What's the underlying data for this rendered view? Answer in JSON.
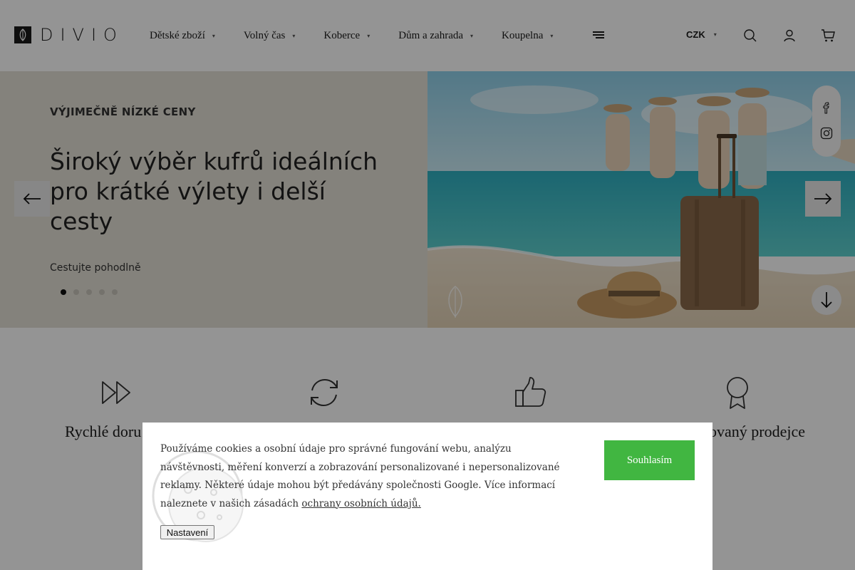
{
  "brand": {
    "name": "DIVIO"
  },
  "nav": {
    "items": [
      {
        "label": "Dětské zboží"
      },
      {
        "label": "Volný čas"
      },
      {
        "label": "Koberce"
      },
      {
        "label": "Dům a zahrada"
      },
      {
        "label": "Koupelna"
      }
    ]
  },
  "header": {
    "currency": "CZK",
    "icons": [
      "search-icon",
      "user-icon",
      "cart-icon"
    ]
  },
  "hero": {
    "eyebrow": "VÝJIMEČNĚ NÍZKÉ CENY",
    "headline": "Široký výběr kufrů ideálních pro krátké výlety i delší cesty",
    "subline": "Cestujte pohodlně",
    "slides_total": 5,
    "active_slide": 1,
    "social": [
      "facebook-icon",
      "instagram-icon"
    ]
  },
  "features": {
    "items": [
      {
        "label": "Rychlé doru",
        "icon": "fast-forward-icon"
      },
      {
        "label": "",
        "icon": "refresh-icon"
      },
      {
        "label": "",
        "icon": "thumbs-up-icon"
      },
      {
        "label": "ovaný prodejce",
        "icon": "award-icon"
      }
    ]
  },
  "cookie": {
    "text": "Používáme cookies a osobní údaje pro správné fungování webu, analýzu návštěvnosti, měření konverzí a zobrazování personalizované i nepersonalizované reklamy. Některé údaje mohou být předávány společnosti Google. Více informací naleznete v našich zásadách ",
    "link_label": "ochrany osobních údajů.",
    "accept_label": "Souhlasím",
    "settings_label": "Nastavení"
  },
  "colors": {
    "accent_green": "#41b641",
    "hero_left_bg": "#e4e0d6",
    "text_dark": "#1b1b1b"
  }
}
